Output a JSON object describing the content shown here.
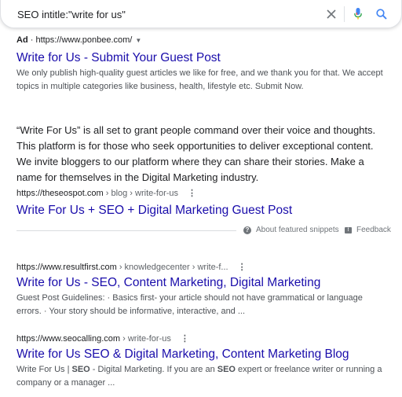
{
  "search": {
    "query": "SEO intitle:\"write for us\""
  },
  "ad": {
    "label": "Ad",
    "sep": " · ",
    "url": "https://www.ponbee.com/",
    "title": "Write for Us - Submit Your Guest Post",
    "snippet": "We only publish high-quality guest articles we like for free, and we thank you for that. We accept topics in multiple categories like business, health, lifestyle etc. Submit Now."
  },
  "featured": {
    "text": "“Write For Us” is all set to grant people command over their voice and thoughts. This platform is for those who seek opportunities to deliver exceptional content. We invite bloggers to our platform where they can share their stories. Make a name for themselves in the Digital Marketing industry.",
    "url": "https://theseospot.com",
    "crumb": " › blog › write-for-us",
    "title": "Write For Us + SEO + Digital Marketing Guest Post",
    "about": "About featured snippets",
    "feedback": "Feedback"
  },
  "results": [
    {
      "url": "https://www.resultfirst.com",
      "crumb": " › knowledgecenter › write-f...",
      "title": "Write for Us - SEO, Content Marketing, Digital Marketing",
      "snippet": "Guest Post Guidelines: · Basics first- your article should not have grammatical or language errors. · Your story should be informative, interactive, and ..."
    },
    {
      "url": "https://www.seocalling.com",
      "crumb": " › write-for-us",
      "title": "Write for Us SEO & Digital Marketing, Content Marketing Blog",
      "snippet_pre": "Write For Us | ",
      "snippet_b1": "SEO",
      "snippet_mid": " - Digital Marketing. If you are an ",
      "snippet_b2": "SEO",
      "snippet_post": " expert or freelance writer or running a company or a manager ..."
    }
  ],
  "icons": {
    "clear": "close-icon",
    "mic": "mic-icon",
    "search": "search-icon",
    "more": "more-vert-icon"
  },
  "colors": {
    "link": "#1a0dab",
    "mic_blue": "#4285f4",
    "mic_red": "#ea4335",
    "search_blue": "#4285f4"
  }
}
